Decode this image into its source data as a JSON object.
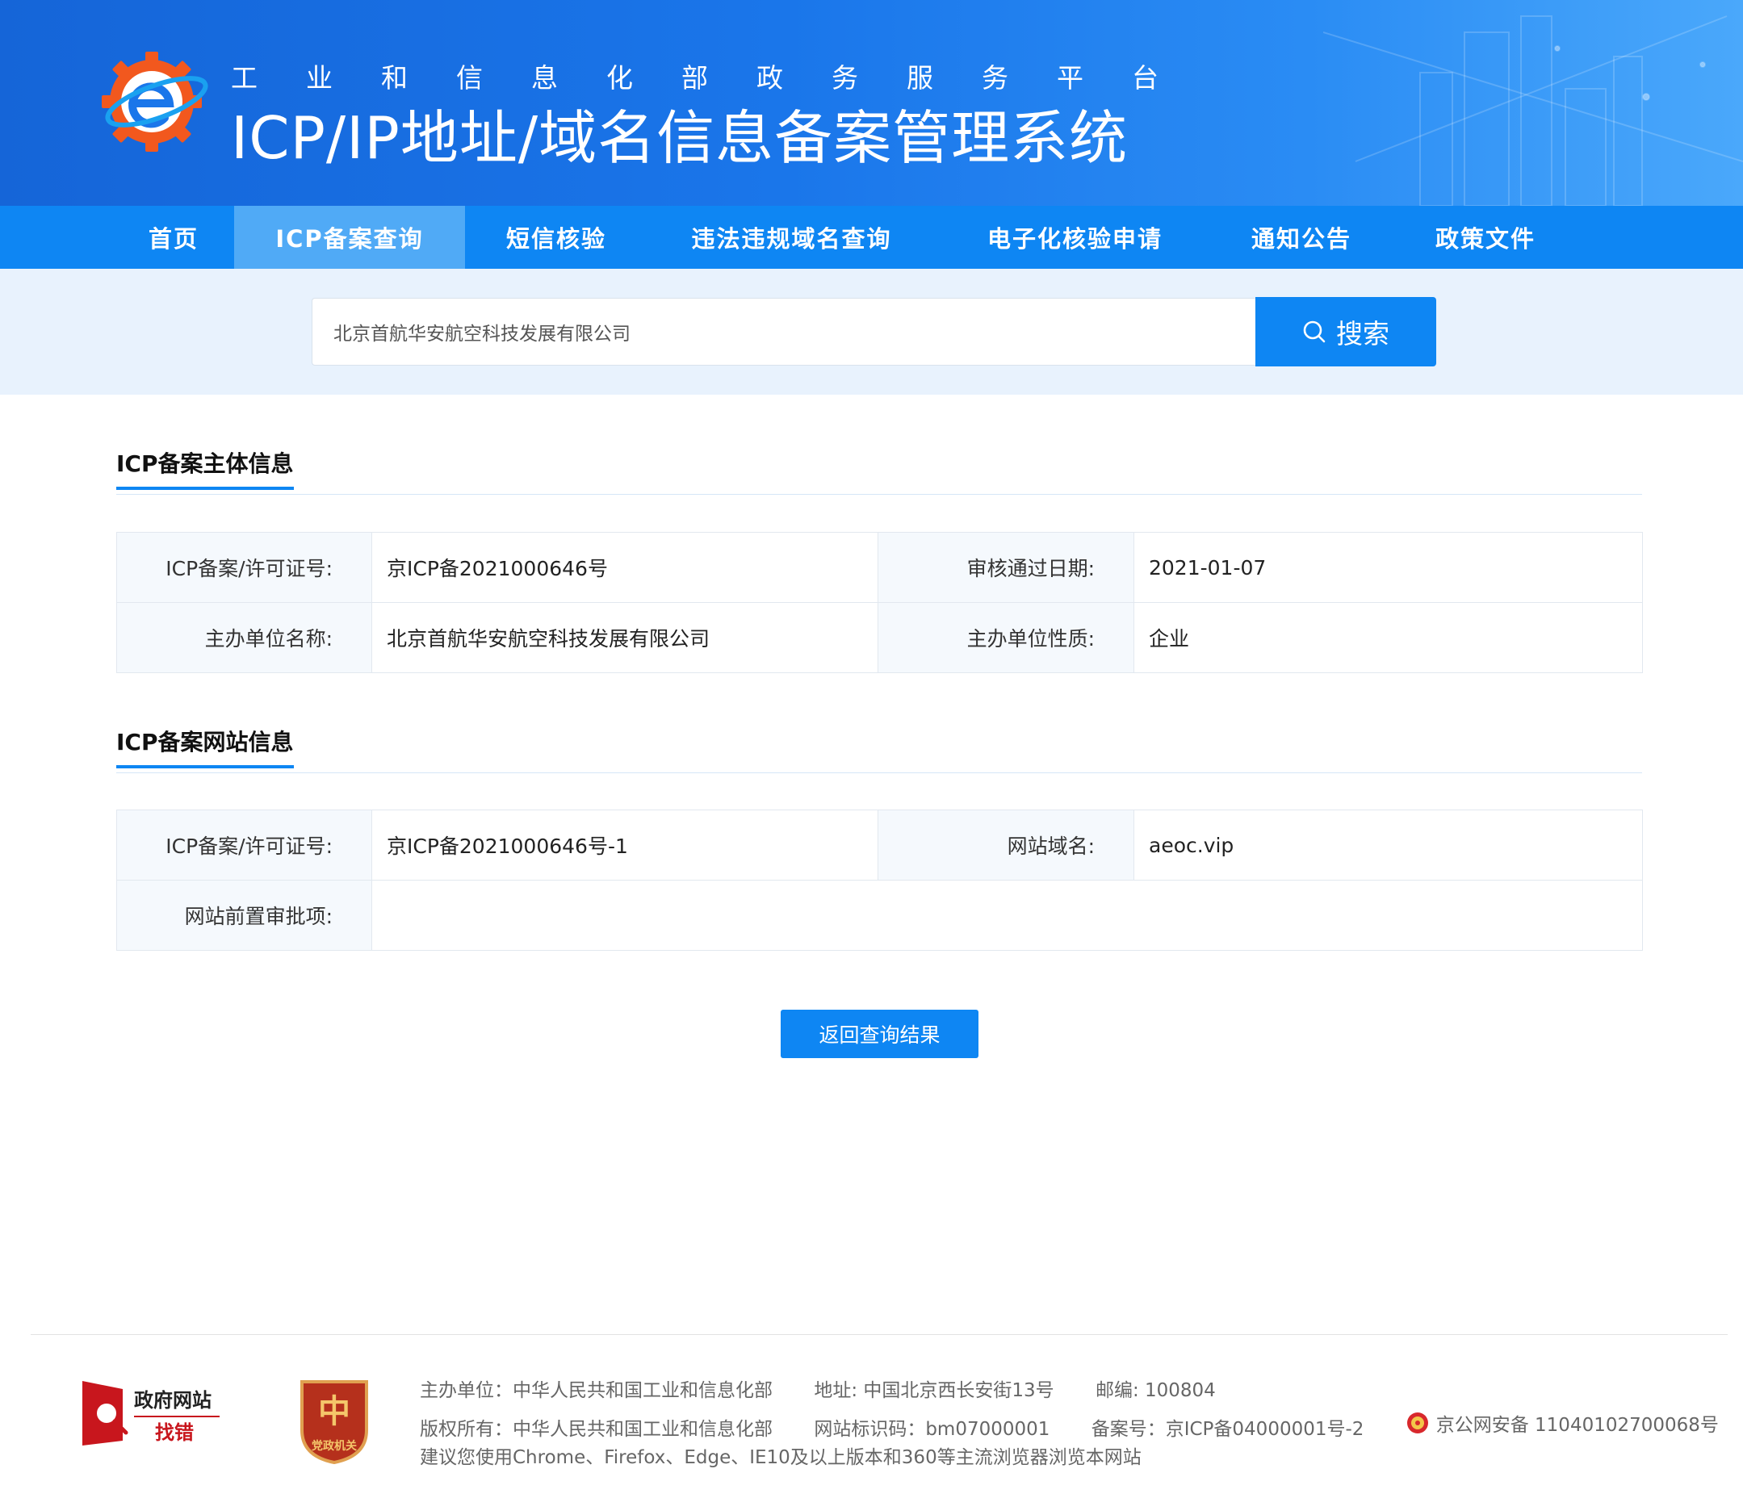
{
  "header": {
    "subtitle": "工业和信息化部政务服务平台",
    "title": "ICP/IP地址/域名信息备案管理系统",
    "logo_icon": "gear-e-logo-icon",
    "colors": {
      "primary": "#0e86f3",
      "nav_active": "#50aaf6",
      "logo_orange": "#f2581e"
    }
  },
  "nav": {
    "items": [
      {
        "label": "首页"
      },
      {
        "label": "ICP备案查询"
      },
      {
        "label": "短信核验"
      },
      {
        "label": "违法违规域名查询"
      },
      {
        "label": "电子化核验申请"
      },
      {
        "label": "通知公告"
      },
      {
        "label": "政策文件"
      }
    ],
    "active": "ICP备案查询"
  },
  "search": {
    "value": "北京首航华安航空科技发展有限公司",
    "button_label": "搜索",
    "button_icon": "search-icon"
  },
  "subject_section": {
    "title": "ICP备案主体信息",
    "rows": [
      {
        "label": "ICP备案/许可证号:",
        "value": "京ICP备2021000646号",
        "label2": "审核通过日期:",
        "value2": "2021-01-07"
      },
      {
        "label": "主办单位名称:",
        "value": "北京首航华安航空科技发展有限公司",
        "label2": "主办单位性质:",
        "value2": "企业"
      }
    ]
  },
  "website_section": {
    "title": "ICP备案网站信息",
    "rows": [
      {
        "label": "ICP备案/许可证号:",
        "value": "京ICP备2021000646号-1",
        "label2": "网站域名:",
        "value2": "aeoc.vip"
      },
      {
        "label": "网站前置审批项:",
        "value": ""
      }
    ]
  },
  "back_button": "返回查询结果",
  "footer": {
    "gov_badge_line1": "政府网站",
    "gov_badge_line2": "找错",
    "party_badge_text": "党政机关",
    "row1": {
      "host": "主办单位：中华人民共和国工业和信息化部",
      "address": "地址: 中国北京西长安街13号",
      "postcode": "邮编: 100804"
    },
    "row2": {
      "copyright": "版权所有：中华人民共和国工业和信息化部",
      "site_code": "网站标识码：bm07000001",
      "record": "备案号：京ICP备04000001号-2",
      "police": "京公网安备 11040102700068号"
    },
    "row3": "建议您使用Chrome、Firefox、Edge、IE10及以上版本和360等主流浏览器浏览本网站"
  }
}
